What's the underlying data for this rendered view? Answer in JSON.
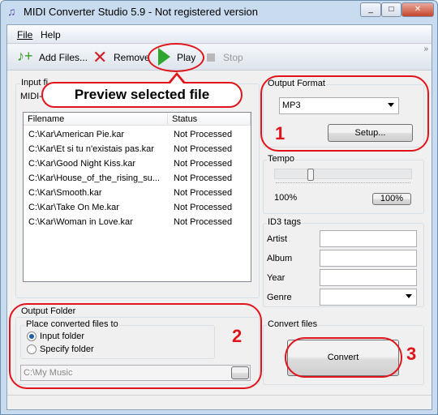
{
  "window": {
    "title": "MIDI Converter Studio 5.9 - Not registered version",
    "buttons": [
      "_",
      "□",
      "✕"
    ]
  },
  "menu": [
    {
      "label": "File"
    },
    {
      "label": "Help"
    }
  ],
  "toolbar": {
    "add": "Add Files...",
    "remove": "Remove",
    "play": "Play",
    "stop": "Stop",
    "overflow": "»"
  },
  "callout": {
    "text": "Preview selected file"
  },
  "input": {
    "label": "Input fi",
    "sub": "MIDI-",
    "columns": [
      "Filename",
      "Status"
    ],
    "rows": [
      {
        "file": "C:\\Kar\\American Pie.kar",
        "status": "Not Processed"
      },
      {
        "file": "C:\\Kar\\Et si tu n'existais pas.kar",
        "status": "Not Processed"
      },
      {
        "file": "C:\\Kar\\Good Night Kiss.kar",
        "status": "Not Processed"
      },
      {
        "file": "C:\\Kar\\House_of_the_rising_su...",
        "status": "Not Processed"
      },
      {
        "file": "C:\\Kar\\Smooth.kar",
        "status": "Not Processed"
      },
      {
        "file": "C:\\Kar\\Take On Me.kar",
        "status": "Not Processed"
      },
      {
        "file": "C:\\Kar\\Woman in Love.kar",
        "status": "Not Processed"
      }
    ]
  },
  "output_format": {
    "label": "Output Format",
    "value": "MP3",
    "setup": "Setup...",
    "marker": "1"
  },
  "tempo": {
    "label": "Tempo",
    "value_text": "100%",
    "reset": "100%",
    "slider_fraction": 0.25
  },
  "id3": {
    "label": "ID3 tags",
    "artist": "Artist",
    "album": "Album",
    "year": "Year",
    "genre": "Genre"
  },
  "output_folder": {
    "label": "Output Folder",
    "place": "Place converted files to",
    "opt1": "Input folder",
    "opt2": "Specify folder",
    "selected": "Input folder",
    "path": "C:\\My Music",
    "marker": "2"
  },
  "convert": {
    "label": "Convert files",
    "button": "Convert",
    "marker": "3"
  },
  "colors": {
    "annotation": "#e0141a"
  }
}
